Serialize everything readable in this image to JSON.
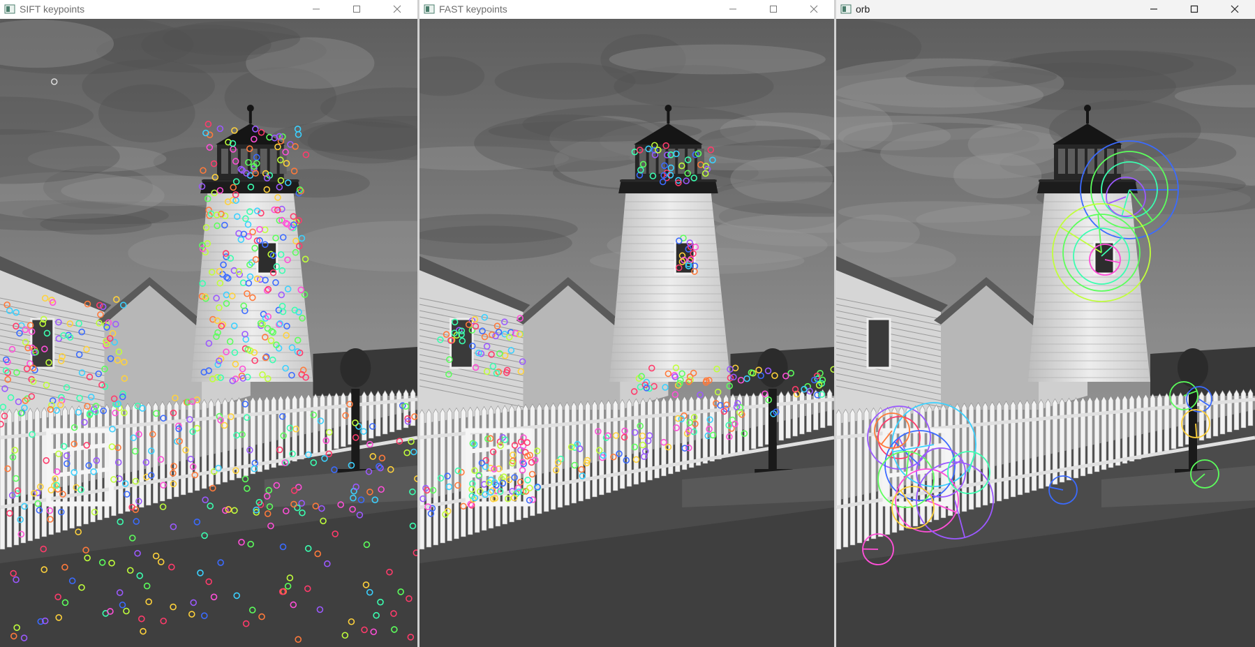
{
  "windows": [
    {
      "id": "sift",
      "title": "SIFT keypoints",
      "focused": false
    },
    {
      "id": "fast",
      "title": "FAST keypoints",
      "focused": false
    },
    {
      "id": "orb",
      "title": "orb",
      "focused": true
    }
  ],
  "controls": {
    "minimize": "minimize-icon",
    "maximize": "maximize-icon",
    "close": "close-icon"
  },
  "image": {
    "subject": "grayscale lighthouse with white picket fence",
    "palette": {
      "sky": "#6e6e6e",
      "tower": "#e4e4e4",
      "ground": "#4a4a4a"
    }
  },
  "keypoint_colors": [
    "#ff4fd8",
    "#3bd1ff",
    "#5cff5c",
    "#ffd23b",
    "#9b59ff",
    "#ff7a3b",
    "#3b6bff",
    "#3bffb0",
    "#ff3b6b",
    "#c0ff3b"
  ]
}
